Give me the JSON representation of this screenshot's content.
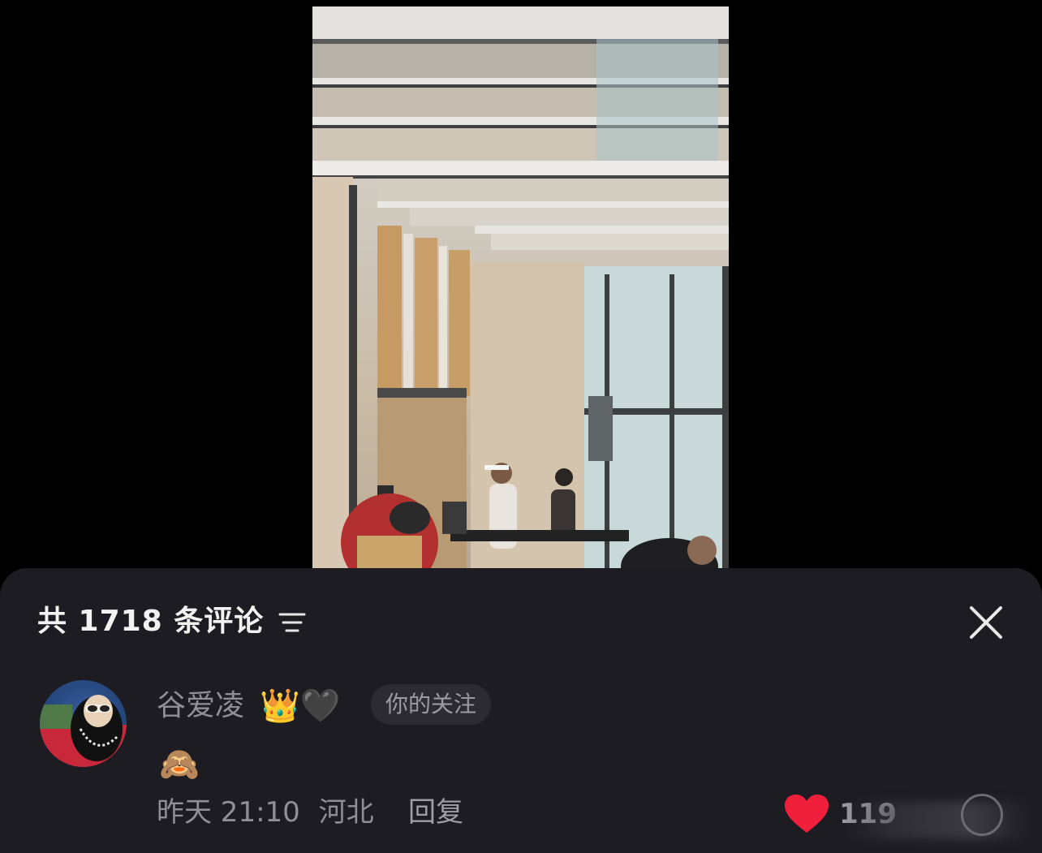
{
  "comments_panel": {
    "title": "共 1718 条评论",
    "filter_icon": "filter-lines-icon",
    "close_icon": "close-x-icon"
  },
  "comment": {
    "username": "谷爱凌",
    "badges": "👑🖤",
    "follow_tag": "你的关注",
    "text": "🙈",
    "time": "昨天 21:10",
    "location": "河北",
    "reply_label": "回复",
    "like_count": "119",
    "like_icon": "heart-filled-icon",
    "more_icon": "more-circle-icon"
  },
  "colors": {
    "panel_bg": "#1d1c22",
    "heart": "#f0203c",
    "muted_text": "#8f8f96"
  }
}
